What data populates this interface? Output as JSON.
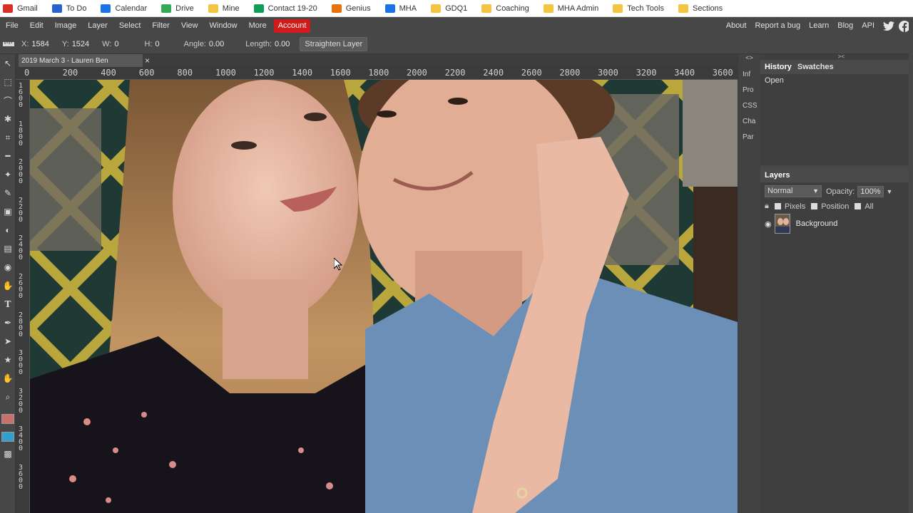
{
  "bookmarks": [
    {
      "label": "Gmail",
      "icon": "gmail-icon",
      "color": "#d93025"
    },
    {
      "label": "To Do",
      "icon": "todo-icon",
      "color": "#2564cf"
    },
    {
      "label": "Calendar",
      "icon": "calendar-icon",
      "color": "#1a73e8"
    },
    {
      "label": "Drive",
      "icon": "drive-icon",
      "color": "#34a853"
    },
    {
      "label": "Mine",
      "icon": "folder-icon",
      "color": "#f4c542"
    },
    {
      "label": "Contact 19-20",
      "icon": "sheets-icon",
      "color": "#0f9d58"
    },
    {
      "label": "Genius",
      "icon": "genius-icon",
      "color": "#e8710a"
    },
    {
      "label": "MHA",
      "icon": "mha-icon",
      "color": "#1a73e8"
    },
    {
      "label": "GDQ1",
      "icon": "folder-icon",
      "color": "#f4c542"
    },
    {
      "label": "Coaching",
      "icon": "folder-icon",
      "color": "#f4c542"
    },
    {
      "label": "MHA Admin",
      "icon": "folder-icon",
      "color": "#f4c542"
    },
    {
      "label": "Tech Tools",
      "icon": "folder-icon",
      "color": "#f4c542"
    },
    {
      "label": "Sections",
      "icon": "folder-icon",
      "color": "#f4c542"
    }
  ],
  "menu": {
    "items": [
      "File",
      "Edit",
      "Image",
      "Layer",
      "Select",
      "Filter",
      "View",
      "Window",
      "More"
    ],
    "account": "Account",
    "right": [
      "About",
      "Report a bug",
      "Learn",
      "Blog",
      "API"
    ]
  },
  "toolopts": {
    "x_label": "X:",
    "x": "1584",
    "y_label": "Y:",
    "y": "1524",
    "w_label": "W:",
    "w": "0",
    "h_label": "H:",
    "h": "0",
    "angle_label": "Angle:",
    "angle": "0.00",
    "length_label": "Length:",
    "length": "0.00",
    "straighten": "Straighten Layer"
  },
  "doc": {
    "tab_title": "2019 March 3 - Lauren Ben",
    "close": "×"
  },
  "rulers": {
    "top": [
      "0",
      "200",
      "400",
      "600",
      "800",
      "1000",
      "1200",
      "1400",
      "1600",
      "1800",
      "2000",
      "2200",
      "2400",
      "2600",
      "2800",
      "3000",
      "3200",
      "3400",
      "3600"
    ],
    "left": [
      "1600",
      "1800",
      "2000",
      "2200",
      "2400",
      "2600",
      "2800",
      "3000",
      "3200",
      "3400",
      "3600"
    ]
  },
  "side_strip": [
    "Inf",
    "Pro",
    "CSS",
    "Cha",
    "Par"
  ],
  "history": {
    "tabs": [
      "History",
      "Swatches"
    ],
    "items": [
      "Open"
    ]
  },
  "layers": {
    "title": "Layers",
    "blend": "Normal",
    "opacity_label": "Opacity:",
    "opacity": "100%",
    "lock_options": [
      "Pixels",
      "Position",
      "All"
    ],
    "items": [
      {
        "name": "Background"
      }
    ]
  }
}
